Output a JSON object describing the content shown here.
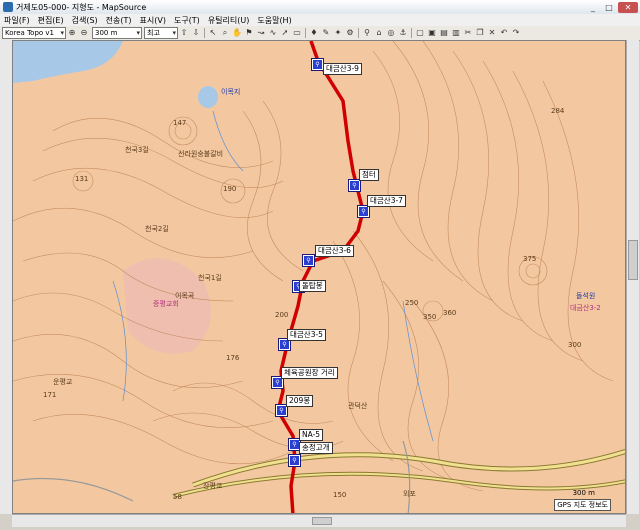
{
  "window": {
    "title": "거제도05-000- 지형도 - MapSource"
  },
  "menu": [
    "파일(F)",
    "편집(E)",
    "검색(S)",
    "전송(T)",
    "표시(V)",
    "도구(T)",
    "유틸리티(U)",
    "도움말(H)"
  ],
  "toolbar": {
    "map_product": "Korea Topo v1",
    "zoom": "300 m",
    "detail": "최고"
  },
  "map": {
    "waypoints": [
      "대금산3-9",
      "점터",
      "대금산3-7",
      "대금산3-6",
      "돌탑봉",
      "대금산3-5",
      "체육공원장 거리",
      "209봉",
      "NA-5",
      "송정고개"
    ],
    "labels": [
      "이목지",
      "천국3길",
      "신라원숭불갈비",
      "천국2길",
      "천국1길",
      "증평교회",
      "운평교",
      "외포",
      "장평교",
      "관덕산",
      "이목곡",
      "대금산3-2",
      "돌석원"
    ],
    "contours": [
      "147",
      "131",
      "190",
      "176",
      "171",
      "200",
      "250",
      "350",
      "284",
      "375",
      "360",
      "300",
      "150",
      "58"
    ],
    "scale_text": "300 m",
    "gps_status": "GPS 지도 정보도"
  },
  "colors": {
    "terrain": "#f3c8a0",
    "contour": "#b7784a",
    "track": "#d00000",
    "water": "#a8c8e8",
    "road": "#f0e090"
  }
}
